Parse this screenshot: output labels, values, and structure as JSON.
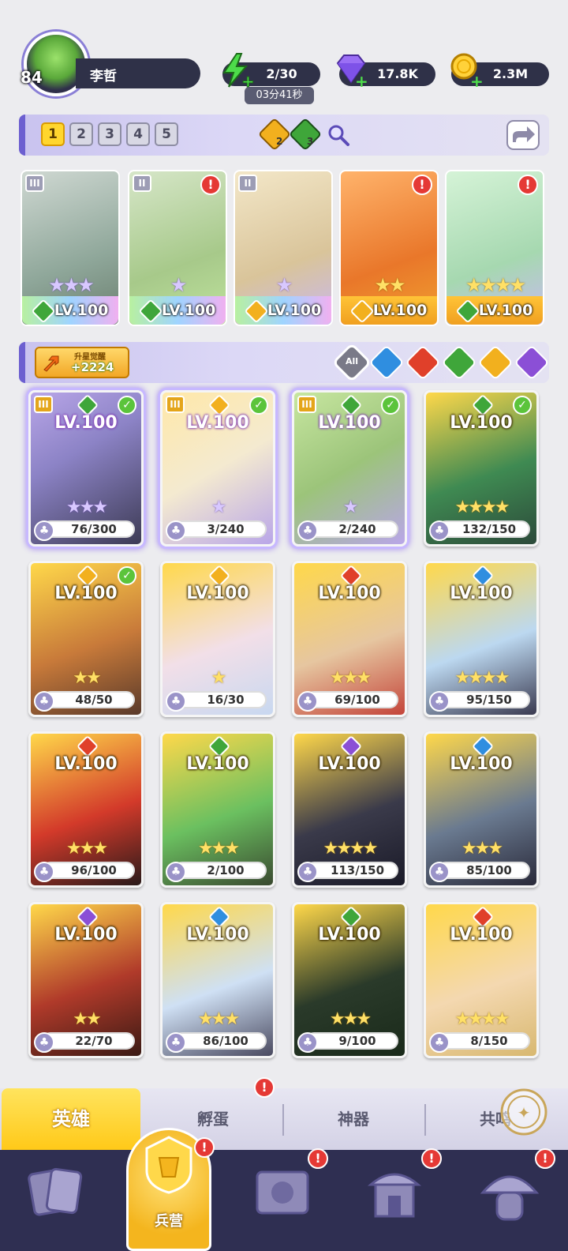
{
  "player": {
    "level": "84",
    "name": "李哲"
  },
  "resources": {
    "energy": "2/30",
    "energy_timer": "03分41秒",
    "gems": "17.8K",
    "coins": "2.3M"
  },
  "team_tabs": [
    "1",
    "2",
    "3",
    "4",
    "5"
  ],
  "team_tab_selected": "1",
  "team_counters": {
    "yellow": "2",
    "green": "3"
  },
  "team": [
    {
      "level": "LV.100",
      "stars": "★★★",
      "element": "green",
      "rank": "III",
      "alert": false
    },
    {
      "level": "LV.100",
      "stars": "★",
      "element": "green",
      "rank": "II",
      "alert": true
    },
    {
      "level": "LV.100",
      "stars": "★",
      "element": "yellow",
      "rank": "II",
      "alert": false
    },
    {
      "level": "LV.100",
      "stars": "★★",
      "element": "yellow",
      "rank": "",
      "alert": true
    },
    {
      "level": "LV.100",
      "stars": "★★★★",
      "element": "green",
      "rank": "",
      "alert": true
    }
  ],
  "upgrade": {
    "label": "升星觉醒",
    "value": "+2224"
  },
  "filters": [
    "All",
    "water",
    "fire",
    "nature",
    "light",
    "dark"
  ],
  "heroes": [
    {
      "level": "LV.100",
      "fragments": "76/300",
      "element": "green",
      "stars": "★★★",
      "check": true,
      "rank": "III",
      "style": "purple"
    },
    {
      "level": "LV.100",
      "fragments": "3/240",
      "element": "yellow",
      "stars": "★",
      "check": true,
      "rank": "III",
      "style": "purple"
    },
    {
      "level": "LV.100",
      "fragments": "2/240",
      "element": "green",
      "stars": "★",
      "check": true,
      "rank": "III",
      "style": "purple"
    },
    {
      "level": "LV.100",
      "fragments": "132/150",
      "element": "green",
      "stars": "★★★★",
      "check": true,
      "rank": "",
      "style": "gold"
    },
    {
      "level": "LV.100",
      "fragments": "48/50",
      "element": "yellow",
      "stars": "★★",
      "check": true,
      "rank": "",
      "style": "gold"
    },
    {
      "level": "LV.100",
      "fragments": "16/30",
      "element": "yellow",
      "stars": "★",
      "check": false,
      "rank": "",
      "style": "gold"
    },
    {
      "level": "LV.100",
      "fragments": "69/100",
      "element": "red",
      "stars": "★★★",
      "check": false,
      "rank": "",
      "style": "gold"
    },
    {
      "level": "LV.100",
      "fragments": "95/150",
      "element": "blue",
      "stars": "★★★★",
      "check": false,
      "rank": "",
      "style": "gold"
    },
    {
      "level": "LV.100",
      "fragments": "96/100",
      "element": "red",
      "stars": "★★★",
      "check": false,
      "rank": "",
      "style": "gold"
    },
    {
      "level": "LV.100",
      "fragments": "2/100",
      "element": "green",
      "stars": "★★★",
      "check": false,
      "rank": "",
      "style": "gold"
    },
    {
      "level": "LV.100",
      "fragments": "113/150",
      "element": "purple",
      "stars": "★★★★",
      "check": false,
      "rank": "",
      "style": "gold"
    },
    {
      "level": "LV.100",
      "fragments": "85/100",
      "element": "blue",
      "stars": "★★★",
      "check": false,
      "rank": "",
      "style": "gold"
    },
    {
      "level": "LV.100",
      "fragments": "22/70",
      "element": "purple",
      "stars": "★★",
      "check": false,
      "rank": "",
      "style": "gold"
    },
    {
      "level": "LV.100",
      "fragments": "86/100",
      "element": "blue",
      "stars": "★★★",
      "check": false,
      "rank": "",
      "style": "gold"
    },
    {
      "level": "LV.100",
      "fragments": "9/100",
      "element": "green",
      "stars": "★★★",
      "check": false,
      "rank": "",
      "style": "gold"
    },
    {
      "level": "LV.100",
      "fragments": "8/150",
      "element": "red",
      "stars": "★★★★",
      "check": false,
      "rank": "",
      "style": "gold"
    }
  ],
  "tabs": {
    "hero": "英雄",
    "egg": "孵蛋",
    "artifact": "神器",
    "resonance": "共鸣"
  },
  "nav": {
    "barracks": "兵营"
  },
  "colors": {
    "green": "#3fa63a",
    "yellow": "#f2b01e",
    "red": "#e0402a",
    "blue": "#2f8ee0",
    "purple": "#8b4fd6",
    "accent": "#6c5fd0"
  }
}
